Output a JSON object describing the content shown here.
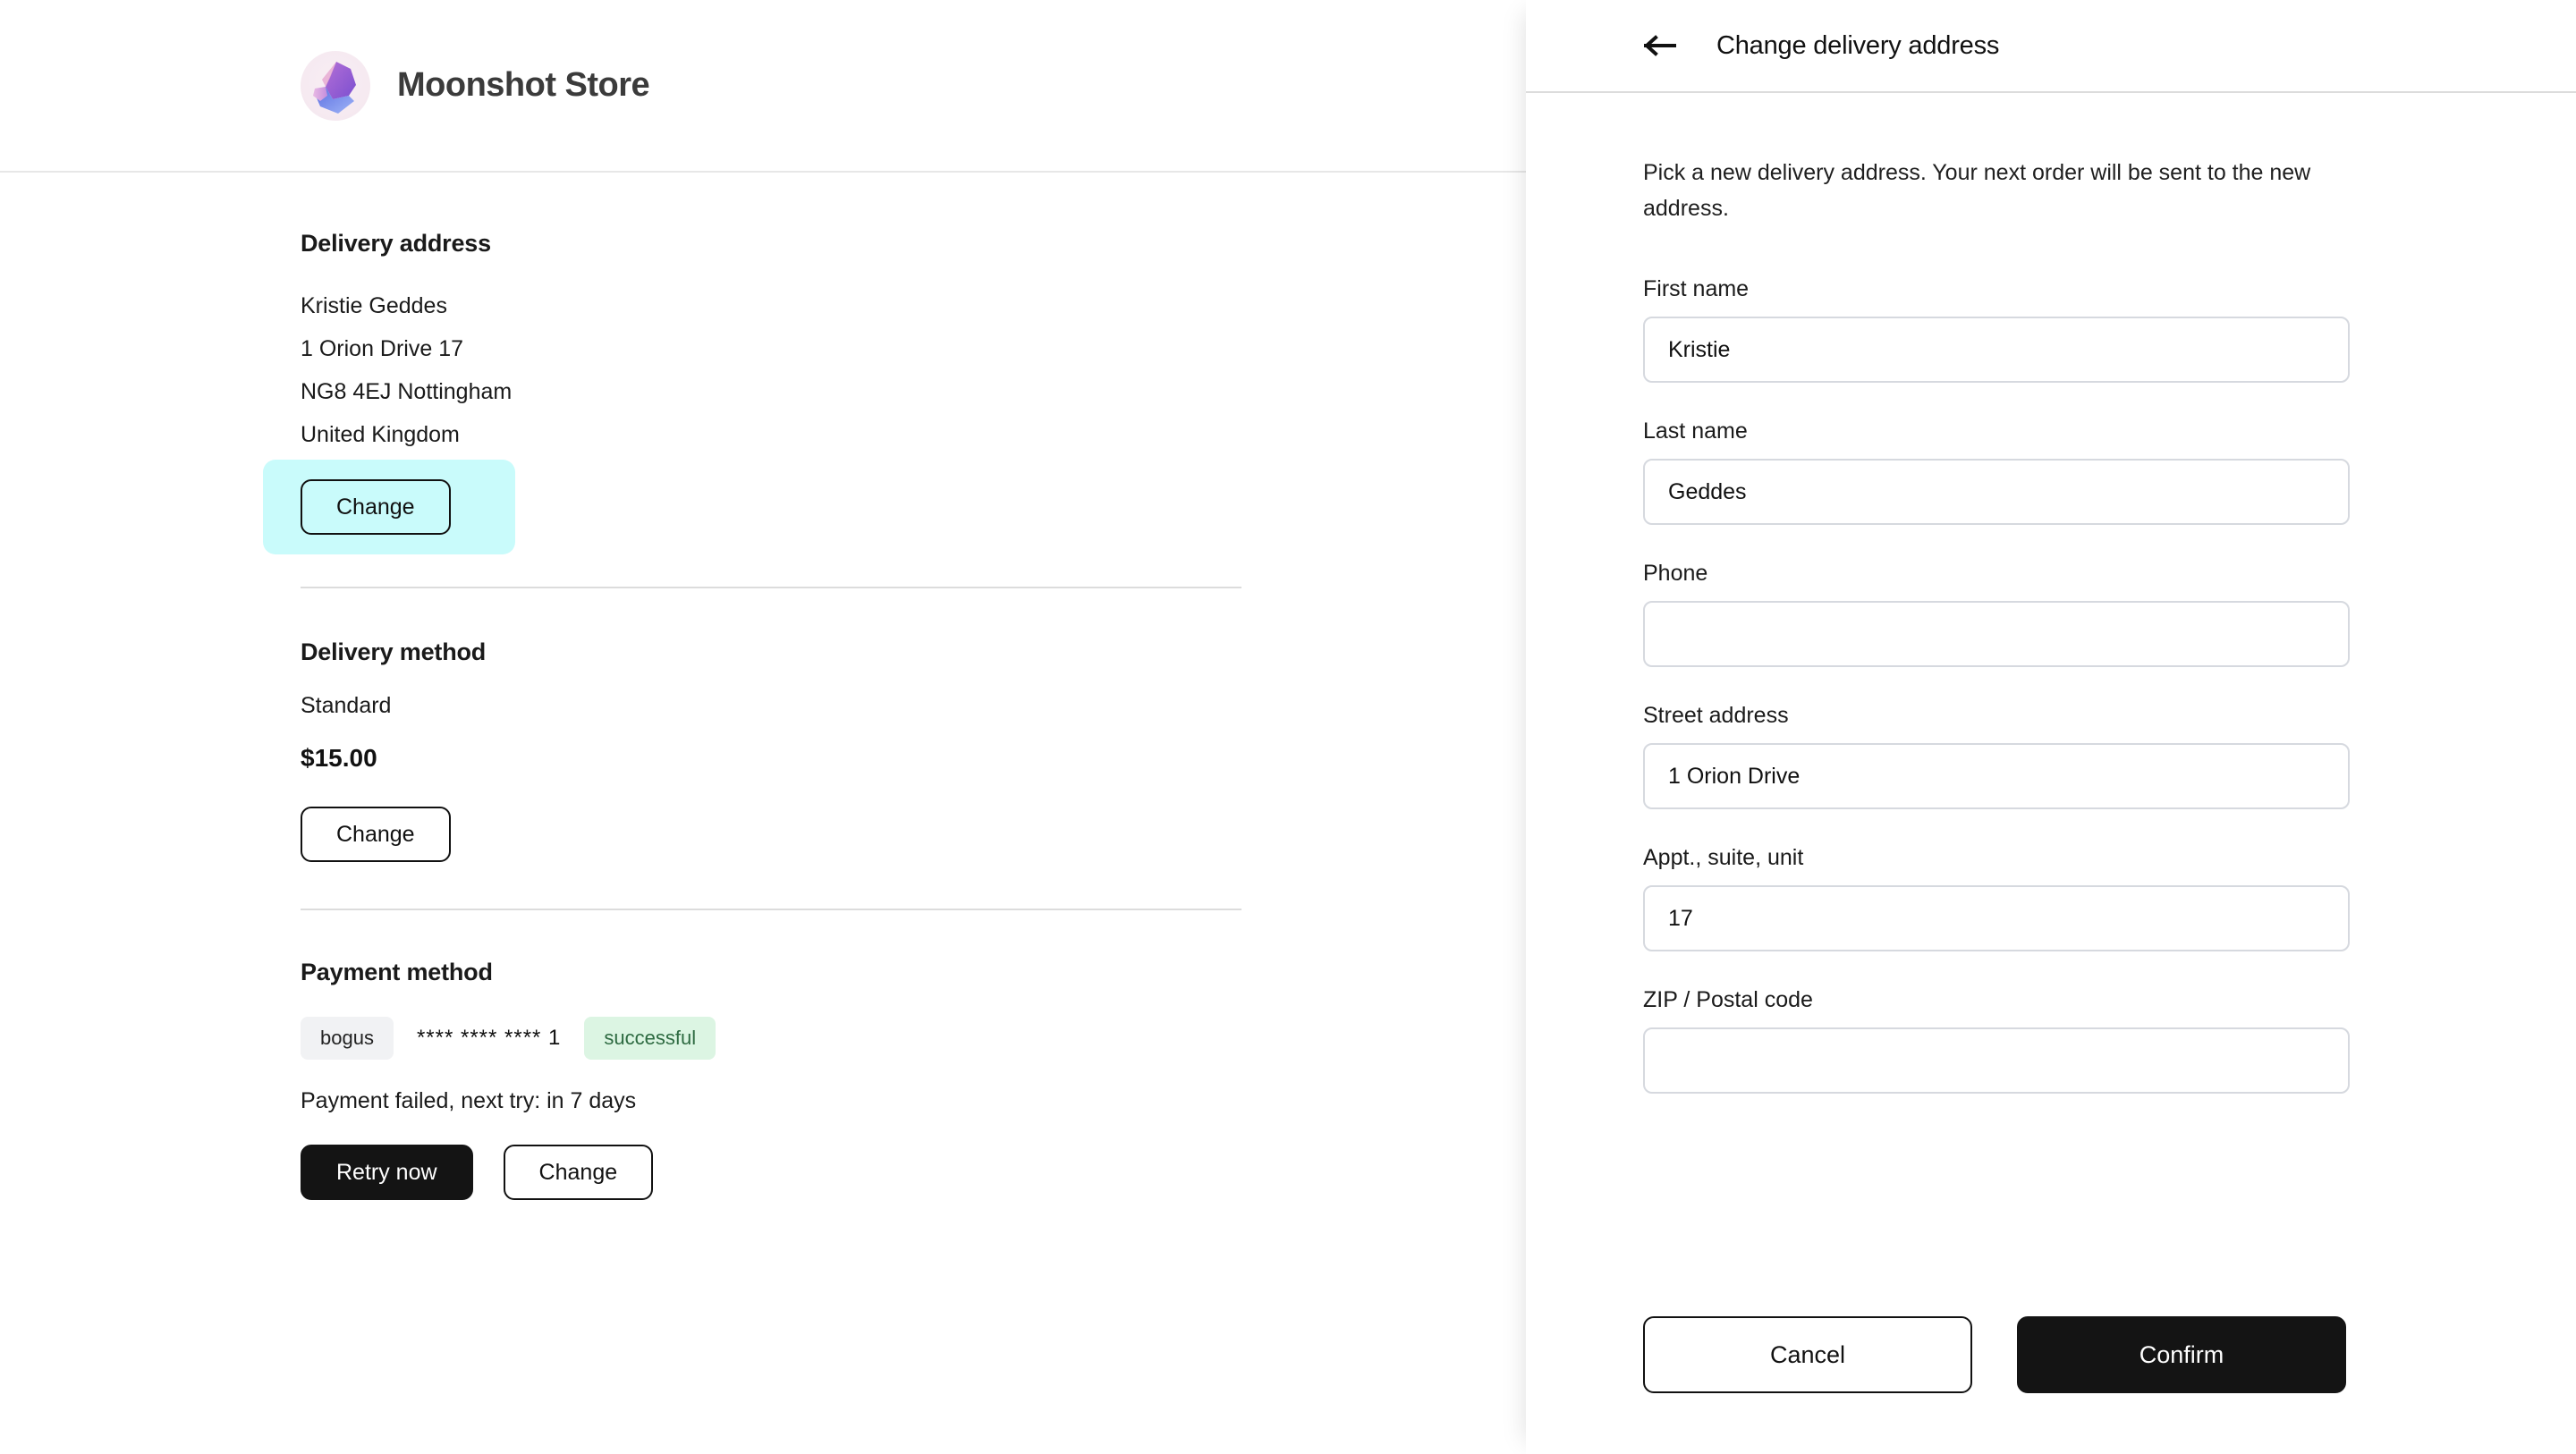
{
  "store": {
    "brand_name": "Moonshot Store",
    "logo_icon": "crystal-gem-logo",
    "delivery_address": {
      "title": "Delivery address",
      "lines": [
        "Kristie Geddes",
        "1 Orion Drive 17",
        "NG8 4EJ Nottingham",
        "United Kingdom"
      ],
      "change_label": "Change",
      "highlight_color": "#c9fbfb"
    },
    "delivery_method": {
      "title": "Delivery method",
      "name": "Standard",
      "price": "$15.00",
      "change_label": "Change"
    },
    "payment_method": {
      "title": "Payment method",
      "provider_badge": "bogus",
      "card_number": "**** **** **** 1",
      "status_badge": "successful",
      "status_color": "#2d6a41",
      "note": "Payment failed, next try: in 7 days",
      "retry_label": "Retry now",
      "change_label": "Change"
    }
  },
  "drawer": {
    "back_icon": "arrow-left-icon",
    "title": "Change delivery address",
    "intro": "Pick a new delivery address. Your next order will be sent to the new address.",
    "fields": [
      {
        "label": "First name",
        "value": "Kristie",
        "placeholder": ""
      },
      {
        "label": "Last name",
        "value": "Geddes",
        "placeholder": ""
      },
      {
        "label": "Phone",
        "value": "",
        "placeholder": ""
      },
      {
        "label": "Street address",
        "value": "1 Orion Drive",
        "placeholder": ""
      },
      {
        "label": "Appt., suite, unit",
        "value": "17",
        "placeholder": ""
      },
      {
        "label": "ZIP / Postal code",
        "value": "",
        "placeholder": ""
      }
    ],
    "cancel_label": "Cancel",
    "confirm_label": "Confirm"
  }
}
